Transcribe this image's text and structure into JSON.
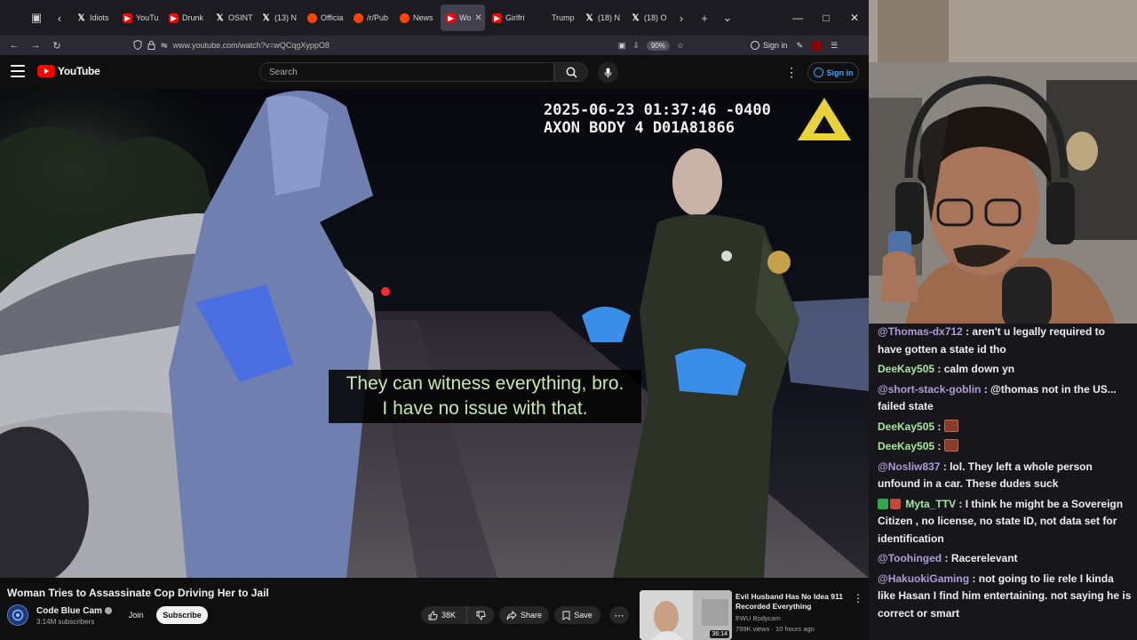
{
  "browser": {
    "tabs": [
      {
        "label": "Idiots",
        "icon": "x-icon",
        "active": false
      },
      {
        "label": "YouTu",
        "icon": "youtube-icon",
        "active": false
      },
      {
        "label": "Drunk",
        "icon": "youtube-icon",
        "active": false
      },
      {
        "label": "OSINT",
        "icon": "x-icon",
        "active": false
      },
      {
        "label": "(13) N",
        "icon": "x-icon",
        "active": false
      },
      {
        "label": "Officia",
        "icon": "reddit-icon",
        "active": false
      },
      {
        "label": "/r/Pub",
        "icon": "reddit-icon",
        "active": false
      },
      {
        "label": "News",
        "icon": "reddit-icon",
        "active": false
      },
      {
        "label": "Wo",
        "icon": "youtube-icon",
        "active": true
      },
      {
        "label": "Girlfri",
        "icon": "youtube-icon",
        "active": false
      },
      {
        "label": "Trump",
        "icon": "blank-icon",
        "active": false
      },
      {
        "label": "(18) N",
        "icon": "x-icon",
        "active": false
      },
      {
        "label": "(18) O",
        "icon": "x-icon",
        "active": false
      }
    ],
    "url": "www.youtube.com/watch?v=wQCqgXyppO8",
    "zoom": "90%",
    "sign_in_label": "Sign in"
  },
  "youtube": {
    "logo_text": "YouTube",
    "search_placeholder": "Search",
    "sign_in_label": "Sign in",
    "video": {
      "overlay_timestamp": "2025-06-23 01:37:46 -0400",
      "overlay_device": "AXON BODY 4 D01A81866",
      "caption_line1": "They can witness everything, bro.",
      "caption_line2": "I have no issue with that."
    },
    "title": "Woman Tries to Assassinate Cop Driving Her to Jail",
    "channel": {
      "name": "Code Blue Cam",
      "subscribers": "3.14M subscribers",
      "join_label": "Join",
      "subscribe_label": "Subscribe"
    },
    "actions": {
      "likes": "38K",
      "share_label": "Share",
      "save_label": "Save"
    },
    "recommendation": {
      "title": "Evil Husband Has No Idea 911 Recorded Everything",
      "channel": "EWU Bodycam",
      "meta": "799K views · 10 hours ago",
      "duration": "36:14"
    }
  },
  "chat": {
    "messages": [
      {
        "user": "@Thomas-dx712",
        "color": "#b19cd9",
        "text": "aren't u legally required to have gotten a state id tho"
      },
      {
        "user": "DeeKay505",
        "color": "#a8e6a1",
        "text": "calm down yn"
      },
      {
        "user": "@short-stack-goblin",
        "color": "#b19cd9",
        "text": "@thomas not in the US... failed state"
      },
      {
        "user": "DeeKay505",
        "color": "#a8e6a1",
        "text": "",
        "emote": true
      },
      {
        "user": "DeeKay505",
        "color": "#a8e6a1",
        "text": "",
        "emote": true
      },
      {
        "user": "@Nosliw837",
        "color": "#b19cd9",
        "text": "lol. They left a whole person unfound in a car. These dudes suck"
      },
      {
        "user": "Myta_TTV",
        "color": "#a8e6a1",
        "text": "I think he might be a Sovereign Citizen , no license, no state ID, not data set for identification",
        "badges": true
      },
      {
        "user": "@Toohinged",
        "color": "#b19cd9",
        "text": "Racerelevant"
      },
      {
        "user": "@HakuokiGaming",
        "color": "#b19cd9",
        "text": "not going to lie rele I kinda like Hasan I find him entertaining. not saying he is correct or smart"
      }
    ]
  }
}
